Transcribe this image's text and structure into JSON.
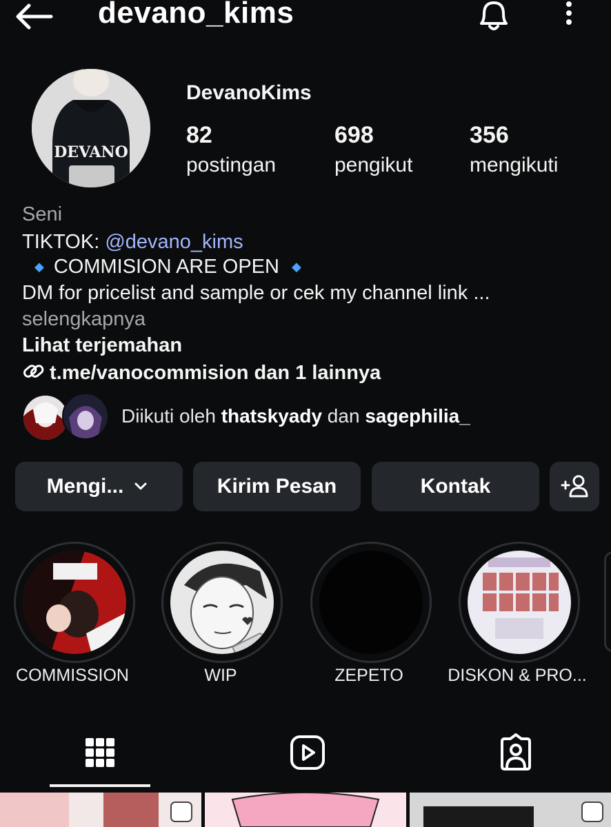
{
  "header": {
    "username": "devano_kims"
  },
  "profile": {
    "display_name": "DevanoKims",
    "avatar_text": "DEVANO",
    "stats": [
      {
        "value": "82",
        "label": "postingan"
      },
      {
        "value": "698",
        "label": "pengikut"
      },
      {
        "value": "356",
        "label": "mengikuti"
      }
    ]
  },
  "bio": {
    "category": "Seni",
    "tiktok_prefix": "TIKTOK: ",
    "tiktok_handle": "@devano_kims",
    "diamond": "◆",
    "commision": "COMMISION ARE OPEN",
    "dm_line": "DM for pricelist and sample or cek my channel link ...",
    "more": "selengkapnya",
    "translate": "Lihat terjemahan",
    "link": "t.me/vanocommision dan 1 lainnya"
  },
  "followed_by": {
    "prefix": "Diikuti oleh ",
    "user1": "thatskyady",
    "middle": " dan ",
    "user2": "sagephilia_"
  },
  "buttons": {
    "following": "Mengi...",
    "message": "Kirim Pesan",
    "contact": "Kontak"
  },
  "highlights": [
    {
      "label": "COMMISSION"
    },
    {
      "label": "WIP"
    },
    {
      "label": "ZEPETO"
    },
    {
      "label": "DISKON & PRO..."
    }
  ],
  "colors": {
    "background": "#0b0c0d",
    "button": "#24272b",
    "link": "#a3b6ff",
    "diamond": "#4aa3ff"
  },
  "icons": [
    "back-arrow-icon",
    "bell-icon",
    "more-vertical-icon",
    "link-icon",
    "chevron-down-icon",
    "add-person-icon",
    "grid-icon",
    "reels-icon",
    "tagged-icon"
  ]
}
